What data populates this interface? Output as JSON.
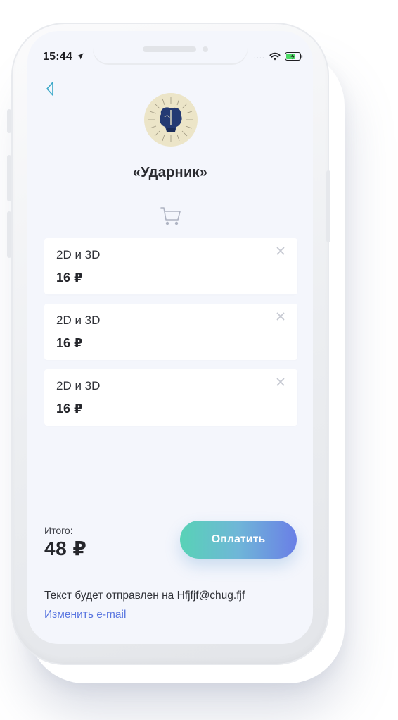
{
  "status_bar": {
    "time": "15:44",
    "signal_dots": "....",
    "icons": [
      "location-arrow-icon",
      "wifi-icon",
      "battery-charging-icon"
    ]
  },
  "header": {
    "back_icon": "back-chevron-icon",
    "logo_icon": "boxing-gloves-icon",
    "title": "«Ударник»"
  },
  "cart": {
    "icon": "cart-icon",
    "items": [
      {
        "name": "2D и 3D",
        "price": "16 ₽",
        "remove_icon": "close-icon"
      },
      {
        "name": "2D и 3D",
        "price": "16 ₽",
        "remove_icon": "close-icon"
      },
      {
        "name": "2D и 3D",
        "price": "16 ₽",
        "remove_icon": "close-icon"
      }
    ]
  },
  "summary": {
    "total_label": "Итого:",
    "total_value": "48 ₽",
    "pay_button": "Оплатить"
  },
  "email": {
    "note": "Текст будет отправлен на Hfjfjf@chug.fjf",
    "change_link": "Изменить e-mail"
  },
  "colors": {
    "accent_start": "#58d2b6",
    "accent_end": "#6a7fe6",
    "link": "#5a76e0",
    "back_icon": "#3aa8c8",
    "logo_bg": "#ece5c8",
    "logo_gloves": "#243a73"
  }
}
